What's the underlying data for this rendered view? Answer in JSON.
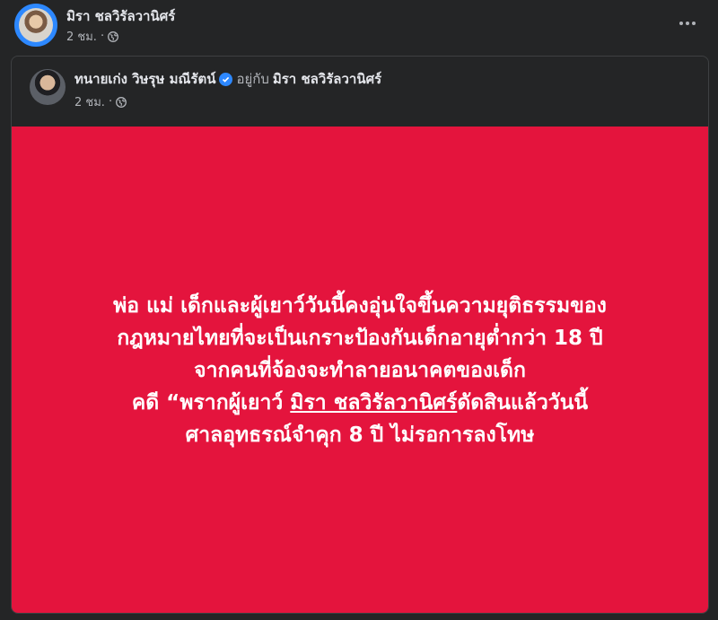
{
  "post": {
    "author": "มิรา ชลวิรัลวานิศร์",
    "time": "2 ชม.",
    "separator": "·",
    "privacy_icon": "globe-icon",
    "more_icon": "more-dots-icon"
  },
  "shared_post": {
    "author": "ทนายเก่ง วิษรุษ มณีรัตน์",
    "verified_icon": "verified-badge-icon",
    "with_text": "อยู่กับ",
    "tagged": "มิรา ชลวิรัลวานิศร์",
    "time": "2 ชม.",
    "separator": "·",
    "privacy_icon": "globe-icon",
    "background_color": "#e4143d",
    "message": {
      "line1": "พ่อ แม่ เด็กและผู้เยาว์วันนี้คงอุ่นใจขึ้นความยุติธรรมของ",
      "line2": "กฎหมายไทยที่จะเป็นเกราะป้องกันเด็กอายุต่ำกว่า 18 ปี",
      "line3": "จากคนที่จ้องจะทำลายอนาคตของเด็ก",
      "line4_prefix": "คดี “พรากผู้เยาว์ ",
      "line4_link": "มิรา ชลวิรัลวานิศร์",
      "line4_suffix": "ดัดสินแล้ววันนี้",
      "line5": "ศาลอุทธรณ์จำคุก 8 ปี ไม่รอการลงโทษ"
    }
  }
}
